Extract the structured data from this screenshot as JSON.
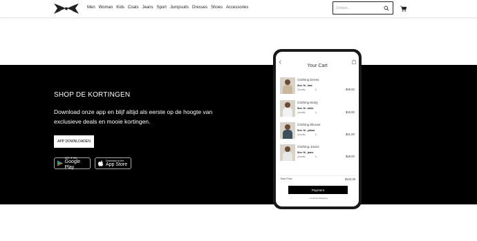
{
  "header": {
    "nav": [
      "Men",
      "Woman",
      "Kids",
      "Coats",
      "Jeans",
      "Sport",
      "Jumpsuits",
      "Dresses",
      "Shoes",
      "Accessories"
    ],
    "search_placeholder": "Zoeken..."
  },
  "promo": {
    "title": "SHOP DE KORTINGEN",
    "text": "Download onze app en blijf altijd als eerste op de hoogte van exclusieve deals en mooie kortingen.",
    "button_label": "APP DOWNLOADEN",
    "google": {
      "small": "GET IT ON",
      "big": "Google Play"
    },
    "apple": {
      "small": "Download on the",
      "big": "App Store"
    }
  },
  "phone": {
    "title": "Your Cart",
    "items": [
      {
        "name": "Clothing Dress",
        "size": "Size: M - blue",
        "qty_label": "Quantity",
        "qty": "1",
        "price": "$39.00",
        "color": "#c9b79c"
      },
      {
        "name": "Clothing Body",
        "size": "Size: M - white",
        "qty_label": "Quantity",
        "qty": "1",
        "price": "$16.00",
        "color": "#f2f2f2"
      },
      {
        "name": "Clothing Blouse",
        "size": "Size: M - yellow",
        "qty_label": "Quantity",
        "qty": "1",
        "price": "$21.00",
        "color": "#3c4f5c"
      },
      {
        "name": "Clothing Jeans",
        "size": "Size: M - jeans",
        "qty_label": "Quantity",
        "qty": "1",
        "price": "$28.00",
        "color": "#e8e8e8"
      }
    ],
    "total_label": "Total Price",
    "total": "$104.00",
    "pay_label": "Payment",
    "continue_label": "← Continue Shopping"
  }
}
